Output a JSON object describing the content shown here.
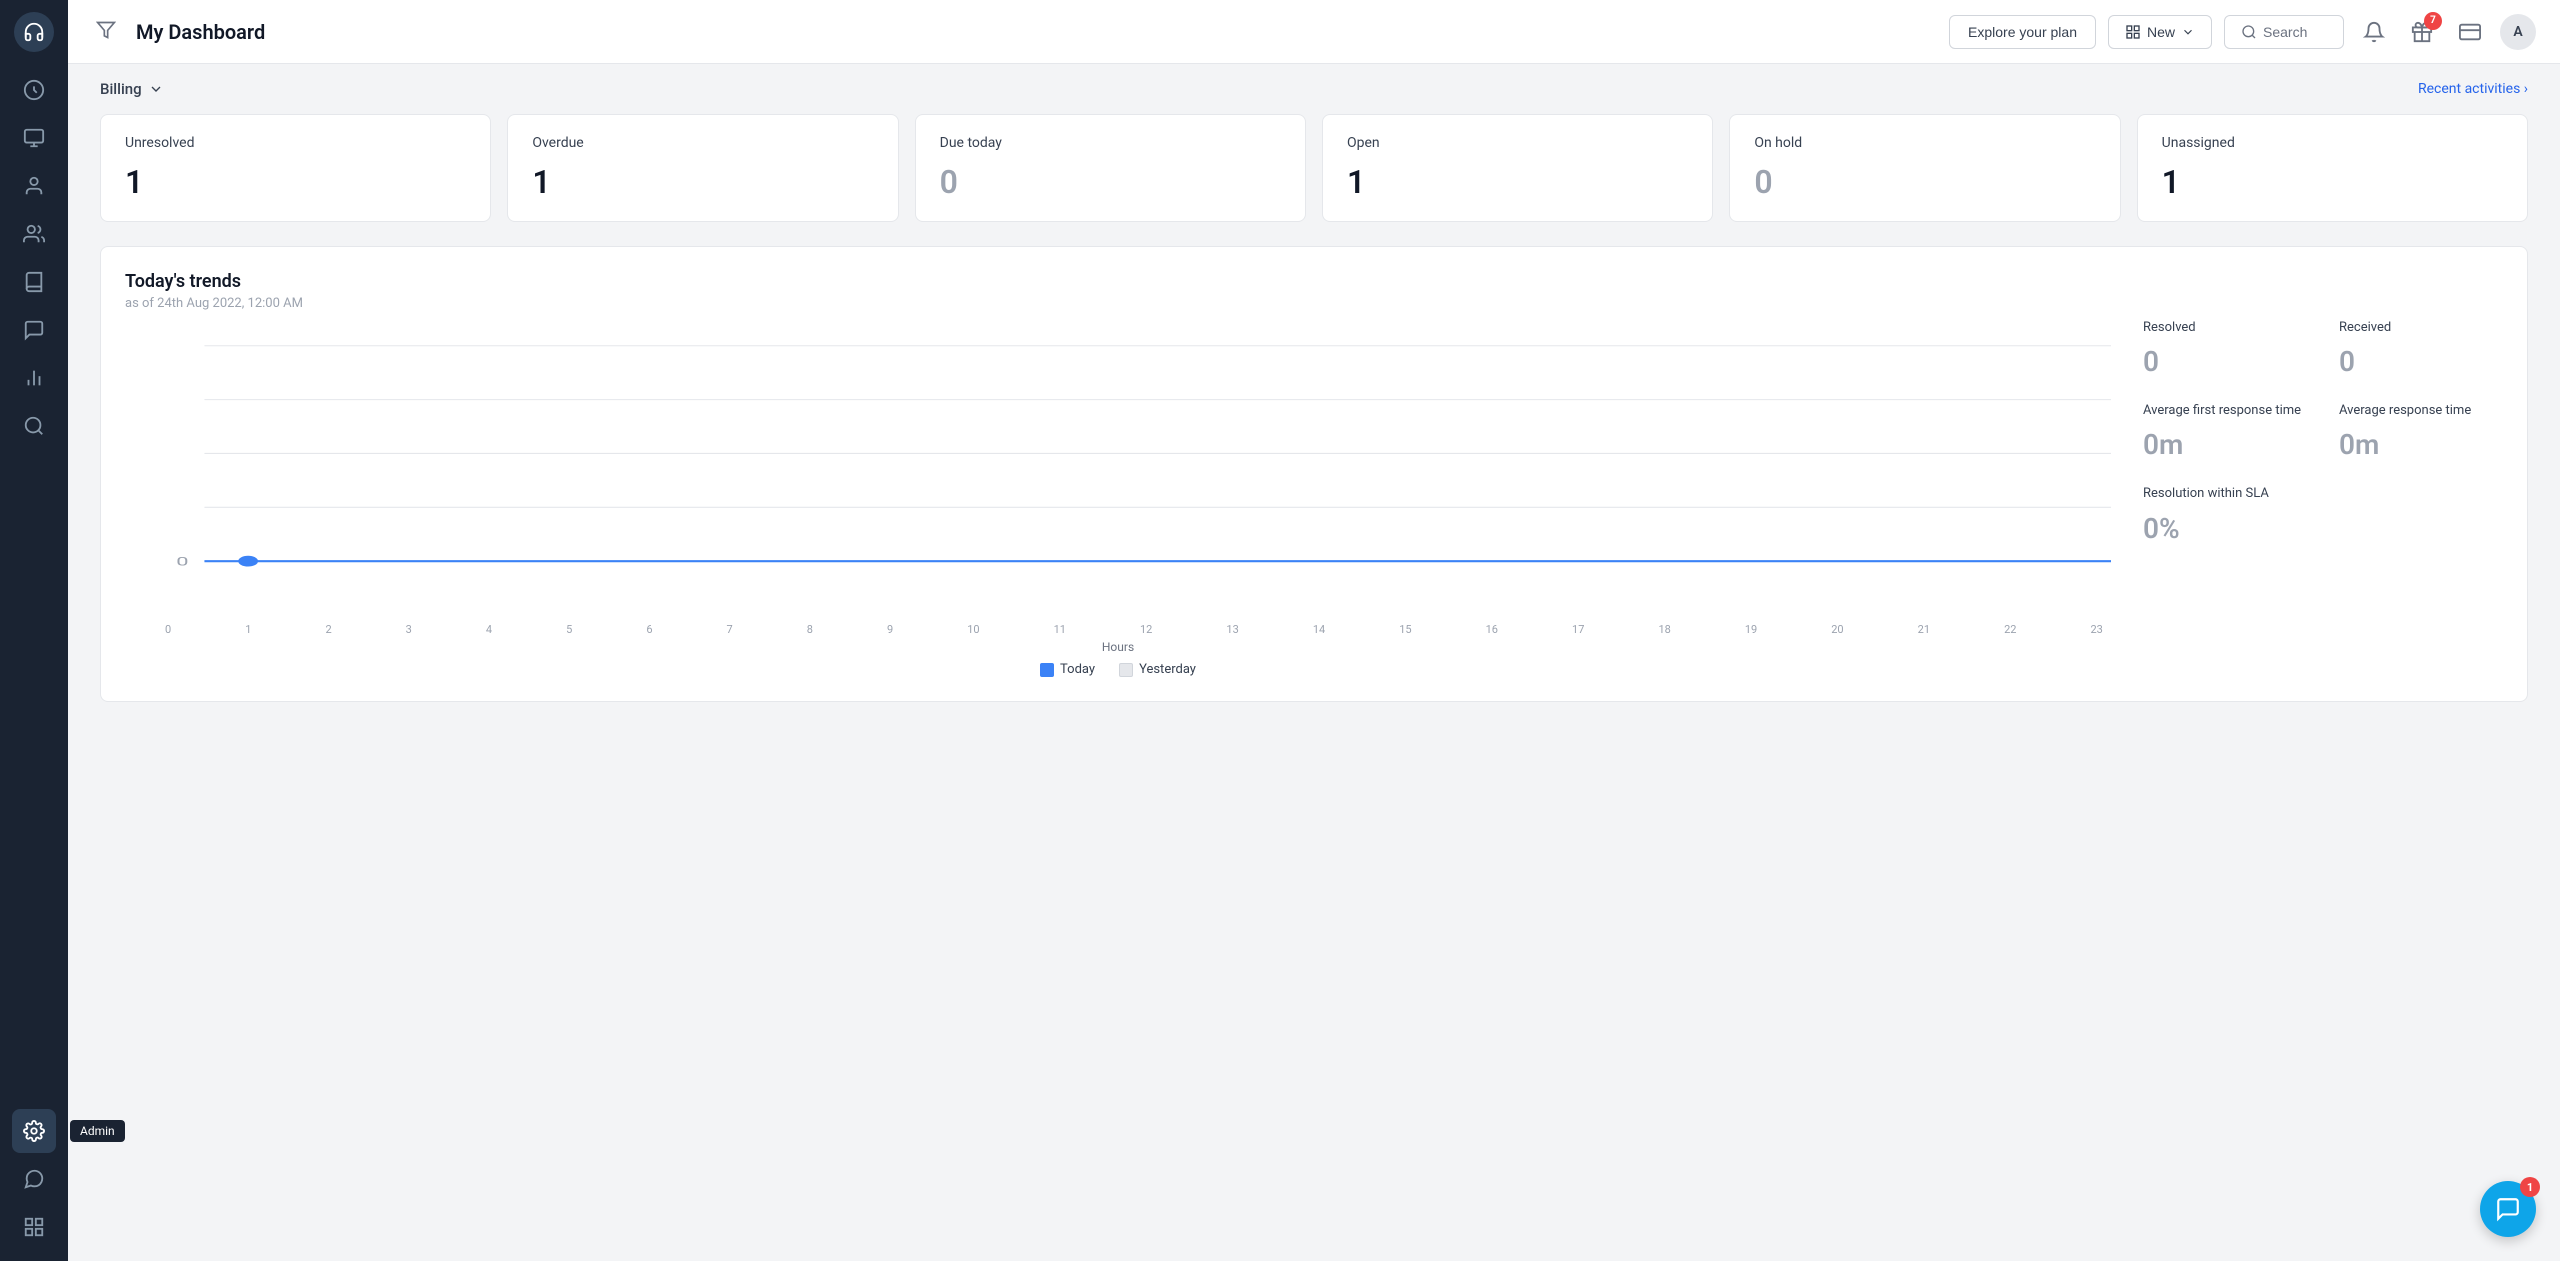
{
  "app": {
    "logo_char": "🎧"
  },
  "topbar": {
    "filter_icon": "filter-icon",
    "title": "My Dashboard",
    "explore_label": "Explore your plan",
    "new_label": "New",
    "search_label": "Search",
    "notifications_badge": "",
    "gift_badge": "7",
    "avatar_label": "A"
  },
  "subheader": {
    "billing_label": "Billing",
    "recent_activities_label": "Recent activities ›"
  },
  "stats": [
    {
      "label": "Unresolved",
      "value": "1",
      "muted": false
    },
    {
      "label": "Overdue",
      "value": "1",
      "muted": false
    },
    {
      "label": "Due today",
      "value": "0",
      "muted": true
    },
    {
      "label": "Open",
      "value": "1",
      "muted": false
    },
    {
      "label": "On hold",
      "value": "0",
      "muted": true
    },
    {
      "label": "Unassigned",
      "value": "1",
      "muted": false
    }
  ],
  "trends": {
    "title": "Today's trends",
    "subtitle": "as of 24th Aug 2022, 12:00 AM",
    "x_axis_labels": [
      "0",
      "1",
      "2",
      "3",
      "4",
      "5",
      "6",
      "7",
      "8",
      "9",
      "10",
      "11",
      "12",
      "13",
      "14",
      "15",
      "16",
      "17",
      "18",
      "19",
      "20",
      "21",
      "22",
      "23"
    ],
    "x_axis_title": "Hours",
    "legend_today": "Today",
    "legend_yesterday": "Yesterday",
    "chart_y_zero": "0",
    "stats": [
      {
        "label": "Resolved",
        "value": "0"
      },
      {
        "label": "Received",
        "value": "0"
      },
      {
        "label": "Average first response time",
        "value": "0m"
      },
      {
        "label": "Average response time",
        "value": "0m"
      },
      {
        "label": "Resolution within SLA",
        "value": "0%",
        "span": true
      }
    ]
  },
  "sidebar": {
    "items": [
      {
        "name": "headphone-icon",
        "label": "Logo"
      },
      {
        "name": "home-icon",
        "label": "Home"
      },
      {
        "name": "inbox-icon",
        "label": "Inbox"
      },
      {
        "name": "contacts-icon",
        "label": "Contacts"
      },
      {
        "name": "people-icon",
        "label": "People"
      },
      {
        "name": "book-icon",
        "label": "Knowledge Base"
      },
      {
        "name": "chat-icon",
        "label": "Chat"
      },
      {
        "name": "reports-icon",
        "label": "Reports"
      },
      {
        "name": "overview-icon",
        "label": "Overview"
      },
      {
        "name": "settings-icon",
        "label": "Admin",
        "tooltip": true,
        "active": true
      },
      {
        "name": "message-icon",
        "label": "Messages"
      },
      {
        "name": "apps-icon",
        "label": "Apps"
      }
    ]
  },
  "tooltip": {
    "admin_label": "Admin"
  },
  "floating": {
    "badge": "1"
  }
}
